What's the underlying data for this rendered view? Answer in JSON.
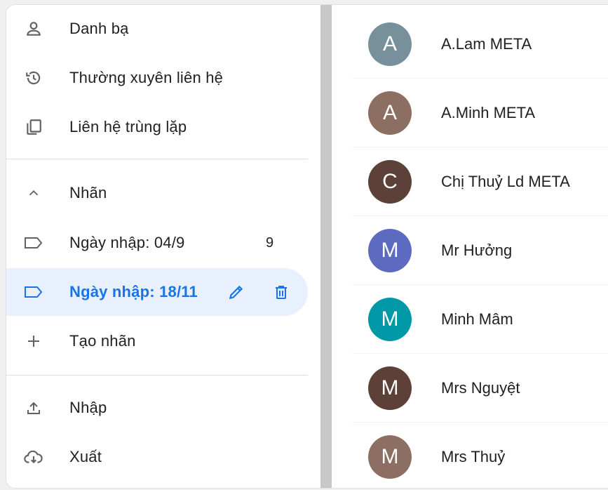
{
  "sidebar": {
    "items": [
      {
        "label": "Danh bạ",
        "icon": "person-icon"
      },
      {
        "label": "Thường xuyên liên hệ",
        "icon": "history-icon"
      },
      {
        "label": "Liên hệ trùng lặp",
        "icon": "duplicate-icon"
      }
    ],
    "labels_header": {
      "label": "Nhãn",
      "icon": "chevron-up-icon"
    },
    "labels": [
      {
        "label": "Ngày nhập: 04/9",
        "count": "9",
        "icon": "label-icon"
      },
      {
        "label": "Ngày nhập: 18/11",
        "icon": "label-icon",
        "selected": true
      }
    ],
    "create_label": {
      "label": "Tạo nhãn",
      "icon": "plus-icon"
    },
    "bottom": [
      {
        "label": "Nhập",
        "icon": "upload-icon"
      },
      {
        "label": "Xuất",
        "icon": "cloud-download-icon"
      }
    ]
  },
  "contacts": [
    {
      "initial": "A",
      "name": "A.Lam META",
      "color": "#78909c"
    },
    {
      "initial": "A",
      "name": "A.Minh META",
      "color": "#8d6e63"
    },
    {
      "initial": "C",
      "name": "Chị Thuỷ Ld META",
      "color": "#5d4037"
    },
    {
      "initial": "M",
      "name": "Mr Hưởng",
      "color": "#5c6bc0"
    },
    {
      "initial": "M",
      "name": "Minh Mâm",
      "color": "#0097a7"
    },
    {
      "initial": "M",
      "name": "Mrs Nguyệt",
      "color": "#5d4037"
    },
    {
      "initial": "M",
      "name": "Mrs Thuỷ",
      "color": "#8d6e63"
    }
  ],
  "colors": {
    "accent": "#1a73e8",
    "selected_bg": "#e8f0fe",
    "icon_gray": "#5f6368"
  }
}
